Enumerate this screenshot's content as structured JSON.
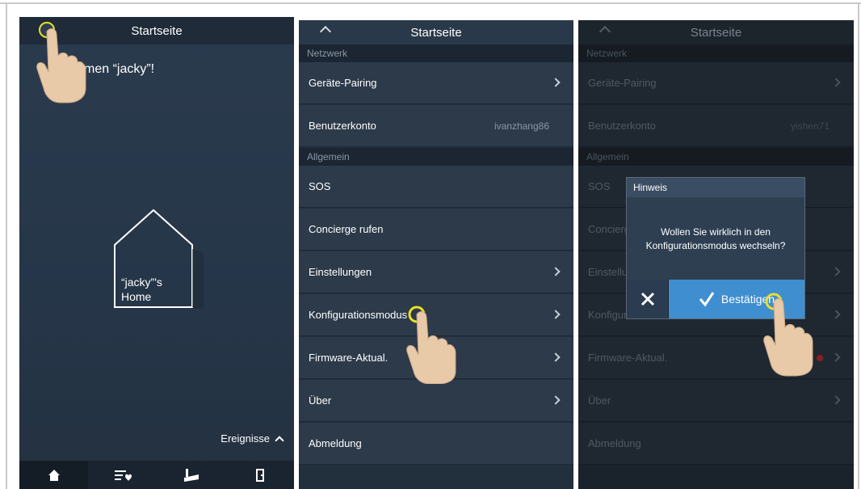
{
  "screens": [
    {
      "title": "Startseite",
      "welcome": "men “jacky”!",
      "house_label_1": "“jacky”'s",
      "house_label_2": "Home",
      "events_label": "Ereignisse",
      "nav_icons": [
        "home-icon",
        "list-heart-icon",
        "camera-icon",
        "door-icon"
      ]
    },
    {
      "title": "Startseite",
      "sections": [
        {
          "label": "Netzwerk",
          "rows": [
            {
              "label": "Geräte-Pairing",
              "chevron": true
            },
            {
              "label": "Benutzerkonto",
              "value": "ivanzhang86"
            }
          ]
        },
        {
          "label": "Allgemein",
          "rows": [
            {
              "label": "SOS"
            },
            {
              "label": "Concierge rufen"
            },
            {
              "label": "Einstellungen",
              "chevron": true
            },
            {
              "label": "Konfigurationsmodus",
              "chevron": true
            },
            {
              "label": "Firmware-Aktual.",
              "chevron": true
            },
            {
              "label": "Über",
              "chevron": true
            },
            {
              "label": "Abmeldung"
            }
          ]
        }
      ]
    },
    {
      "title": "Startseite",
      "sections": [
        {
          "label": "Netzwerk",
          "rows": [
            {
              "label": "Geräte-Pairing",
              "chevron": true
            },
            {
              "label": "Benutzerkonto",
              "value": "yishen71"
            }
          ]
        },
        {
          "label": "Allgemein",
          "rows": [
            {
              "label": "SOS"
            },
            {
              "label": "Concierge rufen"
            },
            {
              "label": "Einstellungen",
              "chevron": true
            },
            {
              "label": "Konfigurationsmodus",
              "chevron": true
            },
            {
              "label": "Firmware-Aktual.",
              "chevron": true
            },
            {
              "label": "Über",
              "chevron": true
            },
            {
              "label": "Abmeldung"
            }
          ]
        }
      ],
      "dialog": {
        "title": "Hinweis",
        "message": "Wollen Sie wirklich in den Konfigurationsmodus wechseln?",
        "confirm": "Bestätigen",
        "cancel_icon": "close-icon",
        "confirm_icon": "checkmark-icon"
      }
    }
  ],
  "colors": {
    "accent": "#3f8ed0",
    "highlight_ring": "#e8e02a"
  }
}
